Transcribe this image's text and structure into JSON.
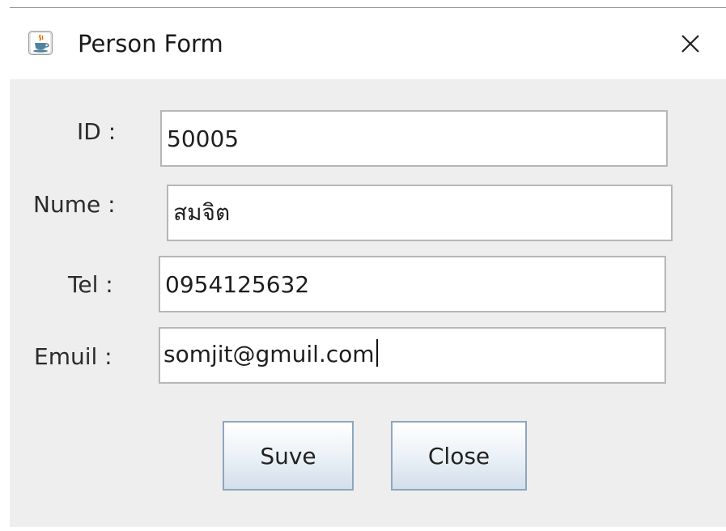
{
  "window": {
    "title": "Person Form",
    "close_glyph": "×"
  },
  "form": {
    "id_label": "ID :",
    "id_value": "50005",
    "name_label": "Nume :",
    "name_value": "สมจิต",
    "tel_label": "Tel :",
    "tel_value": "0954125632",
    "email_label": "Emuil :",
    "email_value": "somjit@gmuil.com"
  },
  "buttons": {
    "save_label": "Suve",
    "close_label": "Close"
  },
  "icons": {
    "app": "java-cup-icon",
    "close": "close-icon"
  },
  "colors": {
    "panel_background": "#eeeeee",
    "field_border": "#b6b6b6",
    "button_border": "#8fa6bd"
  }
}
